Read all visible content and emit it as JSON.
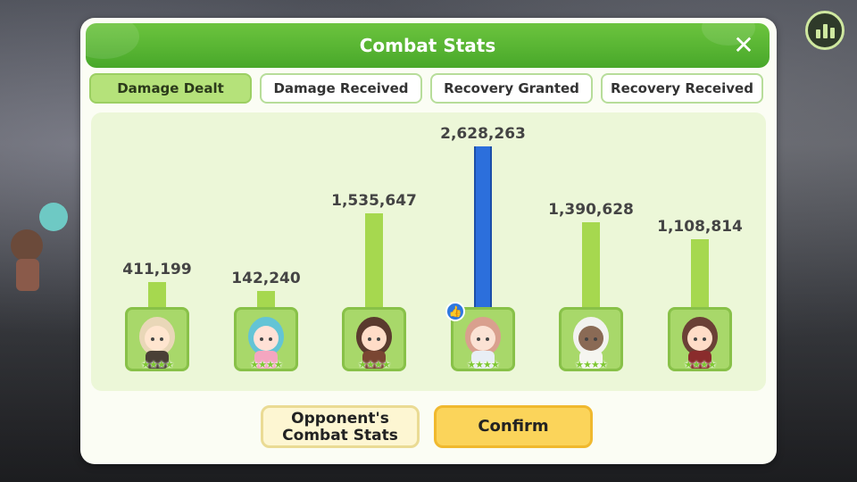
{
  "header": {
    "title": "Combat Stats",
    "close_glyph": "✕"
  },
  "tabs": [
    {
      "label": "Damage Dealt",
      "active": true
    },
    {
      "label": "Damage Received",
      "active": false
    },
    {
      "label": "Recovery Granted",
      "active": false
    },
    {
      "label": "Recovery Received",
      "active": false
    }
  ],
  "chart_data": {
    "type": "bar",
    "categories": [
      "unit-1",
      "unit-2",
      "unit-3",
      "unit-4",
      "unit-5",
      "unit-6"
    ],
    "values": [
      411199,
      142240,
      1535647,
      2628263,
      1390628,
      1108814
    ],
    "value_labels": [
      "411,199",
      "142,240",
      "1,535,647",
      "2,628,263",
      "1,390,628",
      "1,108,814"
    ],
    "highlight_index": 3,
    "bar_color": "#a6d84f",
    "highlight_color": "#2c6fdc",
    "star_count": [
      4,
      4,
      4,
      4,
      4,
      4
    ]
  },
  "buttons": {
    "opponent_label_line1": "Opponent's",
    "opponent_label_line2": "Combat Stats",
    "confirm_label": "Confirm"
  },
  "icons": {
    "stats": "bar-chart-icon",
    "close": "close-icon",
    "mvp": "thumbs-up-icon",
    "star": "star-icon"
  },
  "colors": {
    "header": "#56b133",
    "panel": "#fbfdf4",
    "chart_bg": "#ecf7d8",
    "confirm": "#fbd45a"
  }
}
